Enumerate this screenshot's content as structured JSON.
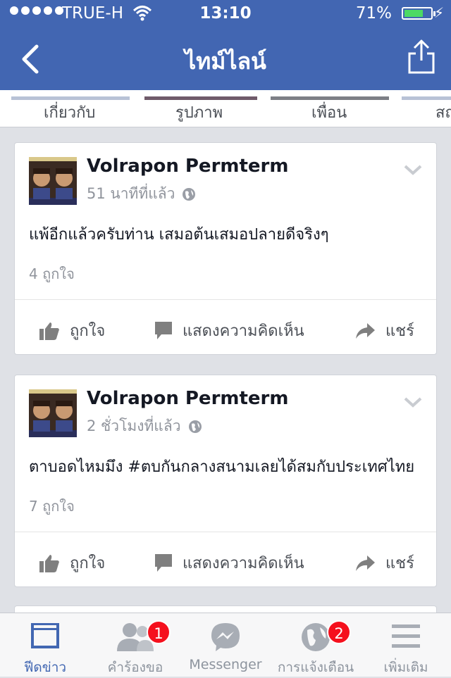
{
  "status_bar": {
    "carrier": "TRUE-H",
    "time": "13:10",
    "battery": "71%",
    "battery_level": 0.71
  },
  "nav": {
    "title": "ไทม์ไลน์"
  },
  "profile_tabs": [
    {
      "label": "เกี่ยวกับ"
    },
    {
      "label": "รูปภาพ"
    },
    {
      "label": "เพื่อน"
    },
    {
      "label": "สถ"
    }
  ],
  "posts": [
    {
      "author": "Volrapon Permterm",
      "time": "51 นาทีที่แล้ว",
      "text": "แพ้อีกแล้วครับท่าน เสมอต้นเสมอปลายดีจริงๆ",
      "likes": "4 ถูกใจ"
    },
    {
      "author": "Volrapon Permterm",
      "time": "2 ชั่วโมงที่แล้ว",
      "text": "ตาบอดไหมมึง #ตบกันกลางสนามเลยได้สมกับประเทศไทย",
      "likes": "7 ถูกใจ"
    }
  ],
  "actions": {
    "like": "ถูกใจ",
    "comment": "แสดงความคิดเห็น",
    "share": "แชร์"
  },
  "tabbar": {
    "items": [
      {
        "label": "ฟีดข่าว",
        "icon": "news-feed-icon"
      },
      {
        "label": "คำร้องขอ",
        "icon": "friend-requests-icon",
        "badge": "1"
      },
      {
        "label": "Messenger",
        "icon": "messenger-icon"
      },
      {
        "label": "การแจ้งเตือน",
        "icon": "globe-notifications-icon",
        "badge": "2"
      },
      {
        "label": "เพิ่มเติม",
        "icon": "menu-icon"
      }
    ]
  },
  "colors": {
    "brand_blue": "#4266b2",
    "badge_red": "#f5101d",
    "battery_green": "#4cd964"
  }
}
